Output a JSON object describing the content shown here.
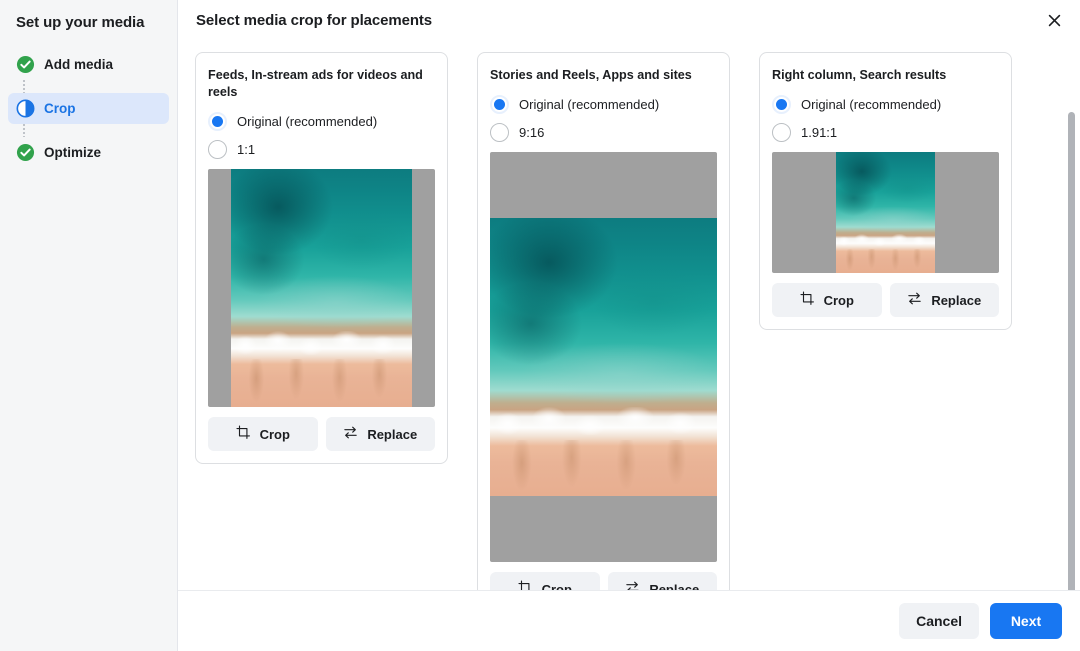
{
  "sidebar": {
    "title": "Set up your media",
    "steps": [
      {
        "label": "Add media",
        "icon": "check-circle-icon",
        "state": "complete"
      },
      {
        "label": "Crop",
        "icon": "half-circle-icon",
        "state": "active"
      },
      {
        "label": "Optimize",
        "icon": "check-circle-icon",
        "state": "complete"
      }
    ]
  },
  "header": {
    "title": "Select media crop for placements",
    "close_icon": "close-icon"
  },
  "cards": [
    {
      "title": "Feeds, In-stream ads for videos and reels",
      "options": [
        {
          "label": "Original (recommended)",
          "selected": true
        },
        {
          "label": "1:1",
          "selected": false
        }
      ],
      "crop_label": "Crop",
      "replace_label": "Replace",
      "crop_icon": "crop-icon",
      "replace_icon": "replace-icon"
    },
    {
      "title": "Stories and Reels, Apps and sites",
      "options": [
        {
          "label": "Original (recommended)",
          "selected": true
        },
        {
          "label": "9:16",
          "selected": false
        }
      ],
      "crop_label": "Crop",
      "replace_label": "Replace",
      "crop_icon": "crop-icon",
      "replace_icon": "replace-icon"
    },
    {
      "title": "Right column, Search results",
      "options": [
        {
          "label": "Original (recommended)",
          "selected": true
        },
        {
          "label": "1.91:1",
          "selected": false
        }
      ],
      "crop_label": "Crop",
      "replace_label": "Replace",
      "crop_icon": "crop-icon",
      "replace_icon": "replace-icon"
    }
  ],
  "footer": {
    "cancel_label": "Cancel",
    "next_label": "Next"
  },
  "colors": {
    "accent": "#1877f2",
    "active_step_text": "#1b74e4",
    "active_step_bg": "#dce7fb",
    "complete_icon": "#31a24c",
    "letterbox": "#a0a0a0",
    "button_bg": "#f0f2f5",
    "sidebar_bg": "#f5f6f7"
  }
}
